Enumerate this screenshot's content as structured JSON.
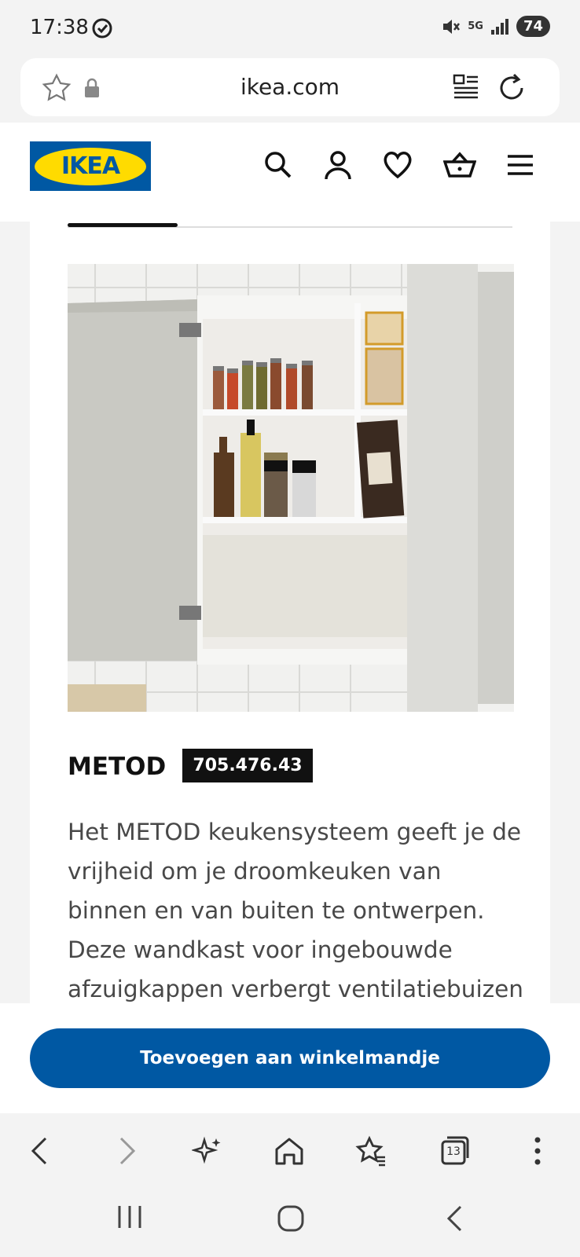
{
  "status_bar": {
    "time": "17:38",
    "network": "5G",
    "battery": "74"
  },
  "address_bar": {
    "url": "ikea.com"
  },
  "header": {
    "logo_text": "IKEA"
  },
  "product": {
    "name": "METOD",
    "code": "705.476.43",
    "description": "Het METOD keukensysteem geeft je de vrijheid om je droomkeuken van binnen en van buiten te ontwerpen. Deze wandkast voor ingebouwde afzuigkappen verbergt ventilatiebuizen"
  },
  "cta": {
    "label": "Toevoegen aan winkelmandje"
  },
  "browser_nav": {
    "tabs_count": "13"
  },
  "colors": {
    "brand_blue": "#0058a3",
    "brand_yellow": "#ffdb00"
  }
}
